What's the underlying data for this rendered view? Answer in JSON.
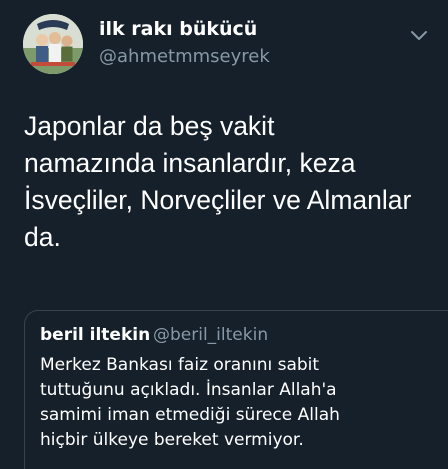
{
  "author": {
    "display_name": "ilk rakı bükücü",
    "handle": "@ahmetmmseyrek",
    "avatar_icon": "profile-photo"
  },
  "menu_icon": "chevron-down-icon",
  "tweet": {
    "lines": [
      "Japonlar da beş vakit",
      "namazında insanlardır, keza",
      "İsveçliler, Norveçliler ve Almanlar",
      "da."
    ]
  },
  "quote": {
    "display_name": "beril iltekin",
    "handle": "@beril_iltekin",
    "lines": [
      "Merkez Bankası faiz oranını sabit",
      "tuttuğunu açıkladı. İnsanlar Allah'a",
      "samimi iman etmediği sürece Allah",
      "hiçbir ülkeye bereket vermiyor."
    ]
  },
  "colors": {
    "background": "#15202b",
    "primary_text": "#ffffff",
    "secondary_text": "#8899a6",
    "border": "#38444d"
  }
}
